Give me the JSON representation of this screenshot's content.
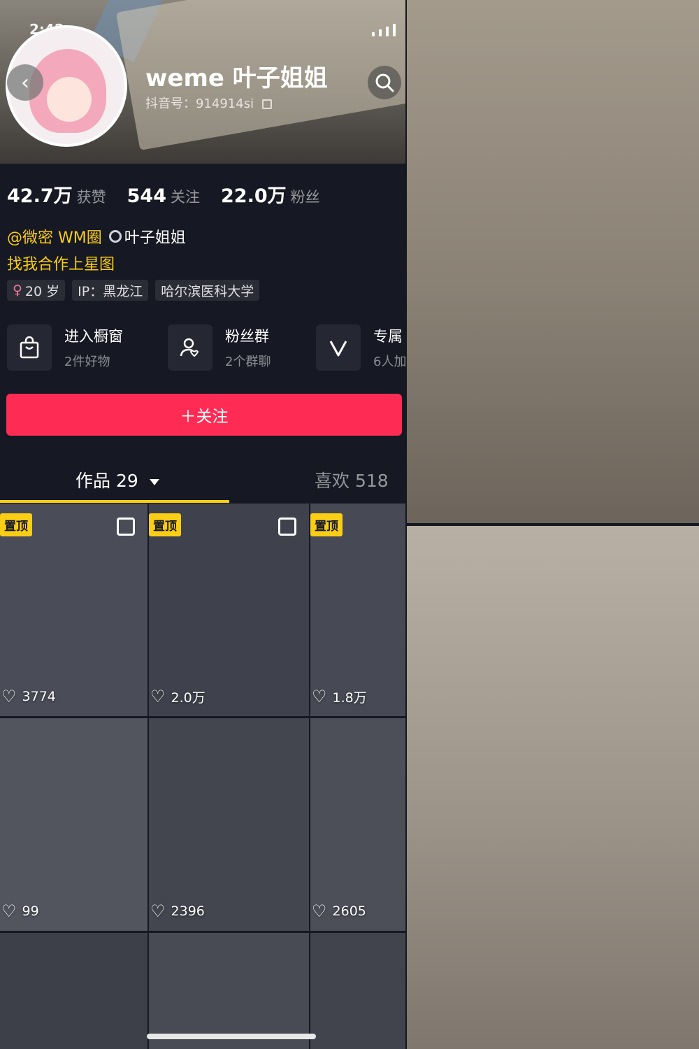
{
  "status_bar": {
    "time": "2:42"
  },
  "profile": {
    "name": "weme 叶子姐姐",
    "douyin_id": "抖音号：914914si"
  },
  "stats": [
    {
      "value": "42.7万",
      "label": "获赞"
    },
    {
      "value": "544",
      "label": "关注"
    },
    {
      "value": "22.0万",
      "label": "粉丝"
    }
  ],
  "bio": {
    "mention": "@微密 WM圈",
    "mention_suffix": "叶子姐姐",
    "line2": "找我合作上星图"
  },
  "tags": [
    {
      "text": "20 岁",
      "icon": "female-icon"
    },
    {
      "text": "IP：黑龙江"
    },
    {
      "text": "哈尔滨医科大学"
    }
  ],
  "shortcuts": [
    {
      "title": "进入橱窗",
      "subtitle": "2件好物",
      "icon": "shopping-bag-icon"
    },
    {
      "title": "粉丝群",
      "subtitle": "2个群聊",
      "icon": "fan-group-icon"
    },
    {
      "title": "专属",
      "subtitle": "6人加",
      "icon": "v-badge-icon"
    }
  ],
  "follow_label": "＋关注",
  "tabs": {
    "works": "作品 29",
    "likes": "喜欢 518"
  },
  "pinned_label": "置顶",
  "videos": [
    {
      "likes": "3774",
      "pinned": true,
      "multi": true
    },
    {
      "likes": "2.0万",
      "pinned": true,
      "multi": true
    },
    {
      "likes": "1.8万",
      "pinned": true,
      "multi": false
    },
    {
      "likes": "99",
      "pinned": false,
      "multi": false
    },
    {
      "likes": "2396",
      "pinned": false,
      "multi": false
    },
    {
      "likes": "2605",
      "pinned": false,
      "multi": false
    },
    {
      "likes": "",
      "pinned": false,
      "multi": false
    },
    {
      "likes": "",
      "pinned": false,
      "multi": false
    },
    {
      "likes": "",
      "pinned": false,
      "multi": false
    }
  ],
  "colors": {
    "background": "#161823",
    "accent_red": "#fe2c55",
    "accent_yellow": "#face15"
  }
}
